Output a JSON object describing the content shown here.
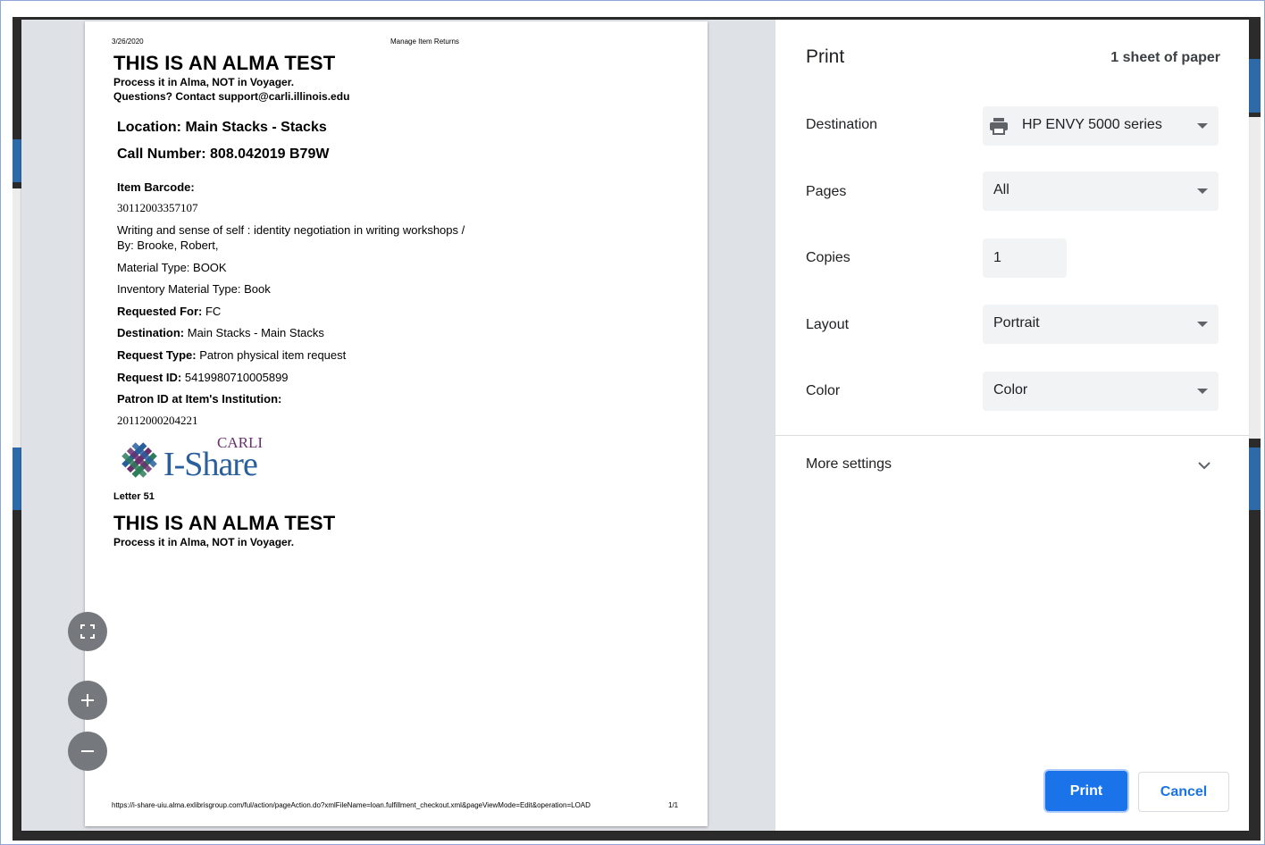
{
  "preview": {
    "header_date": "3/26/2020",
    "header_title": "Manage Item Returns",
    "test_title": "THIS IS AN ALMA TEST",
    "process_note": "Process it in Alma, NOT in Voyager.",
    "contact_note": "Questions? Contact support@carli.illinois.edu",
    "location": "Location: Main Stacks - Stacks",
    "call_number": "Call Number: 808.042019 B79W",
    "item_barcode_label": "Item Barcode:",
    "item_barcode": "30112003357107",
    "title_line1": "Writing and sense of self : identity negotiation in writing workshops /",
    "title_line2": "By: Brooke, Robert,",
    "material_type": "Material Type: BOOK",
    "inventory_material_type": "Inventory Material Type: Book",
    "requested_for_label": "Requested For:",
    "requested_for": "FC",
    "destination_label": "Destination:",
    "destination": "Main Stacks - Main Stacks",
    "request_type_label": "Request Type:",
    "request_type": "Patron physical item request",
    "request_id_label": "Request ID:",
    "request_id": "5419980710005899",
    "patron_id_label": "Patron ID at Item's Institution:",
    "patron_id": "20112000204221",
    "logo_carli": "CARLI",
    "logo_ishare": "I-Share",
    "letter": "Letter 51",
    "test_title_2": "THIS IS AN ALMA TEST",
    "process_note_2": "Process it in Alma, NOT in Voyager.",
    "footer_url": "https://i-share-uiu.alma.exlibrisgroup.com/ful/action/pageAction.do?xmlFileName=loan.fulfillment_checkout.xml&pageViewMode=Edit&operation=LOAD",
    "footer_page": "1/1"
  },
  "settings": {
    "title": "Print",
    "sheet_count": "1 sheet of paper",
    "destination_label": "Destination",
    "destination_value": "HP ENVY 5000 series",
    "pages_label": "Pages",
    "pages_value": "All",
    "copies_label": "Copies",
    "copies_value": "1",
    "layout_label": "Layout",
    "layout_value": "Portrait",
    "color_label": "Color",
    "color_value": "Color",
    "more_settings": "More settings",
    "print_button": "Print",
    "cancel_button": "Cancel"
  },
  "colors": {
    "accent": "#1a73e8",
    "preview_bg": "#dee1e6",
    "select_bg": "#f1f3f4",
    "logo_purple": "#6a2f6f",
    "logo_blue": "#2a5f9e"
  },
  "icons": {
    "fit": "fit-to-page-icon",
    "zoom_in": "plus-icon",
    "zoom_out": "minus-icon",
    "printer": "printer-icon",
    "chevron": "chevron-down-icon"
  }
}
